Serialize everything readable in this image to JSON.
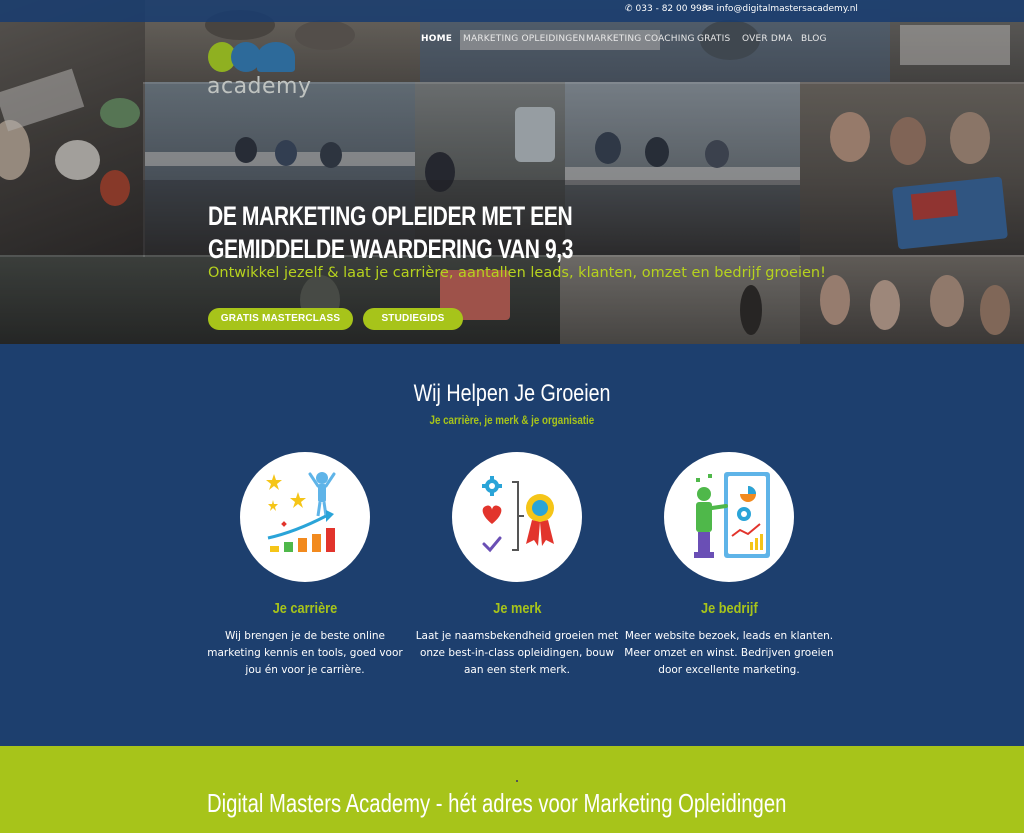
{
  "topbar": {
    "phone": "033 - 82 00 998",
    "email": "info@digitalmastersacademy.nl"
  },
  "logo": {
    "word": "academy"
  },
  "nav": {
    "items": [
      {
        "label": "HOME",
        "active": true
      },
      {
        "label": "MARKETING OPLEIDINGEN",
        "active": false
      },
      {
        "label": "MARKETING COACHING",
        "active": false
      },
      {
        "label": "GRATIS",
        "active": false
      },
      {
        "label": "OVER DMA",
        "active": false
      },
      {
        "label": "BLOG",
        "active": false
      }
    ]
  },
  "hero": {
    "title_line1": "DE MARKETING OPLEIDER MET EEN",
    "title_line2": "GEMIDDELDE WAARDERING VAN 9,3",
    "subtitle": "Ontwikkel jezelf & laat je carrière, aantallen leads, klanten, omzet en bedrijf groeien!",
    "buttons": [
      {
        "label": "GRATIS MASTERCLASS"
      },
      {
        "label": "STUDIEGIDS"
      }
    ]
  },
  "section": {
    "title": "Wij Helpen Je Groeien",
    "subtitle": "Je carrière, je merk & je organisatie",
    "columns": [
      {
        "icon": "career-growth-icon",
        "title": "Je carrière",
        "text": "Wij brengen je de beste online marketing kennis en tools, goed voor jou én voor je carrière."
      },
      {
        "icon": "brand-award-icon",
        "title": "Je merk",
        "text": "Laat je naamsbekendheid groeien met onze best-in-class opleidingen, bouw aan een sterk merk."
      },
      {
        "icon": "business-presentation-icon",
        "title": "Je bedrijf",
        "text": "Meer website bezoek, leads en klanten. Meer omzet en winst. Bedrijven groeien door excellente marketing."
      }
    ]
  },
  "footer_banner": {
    "title": "Digital Masters Academy - hét adres voor Marketing Opleidingen"
  },
  "colors": {
    "brand_green": "#a7c41a",
    "brand_blue": "#1d3f6e",
    "logo_blue": "#2d6a9a"
  }
}
